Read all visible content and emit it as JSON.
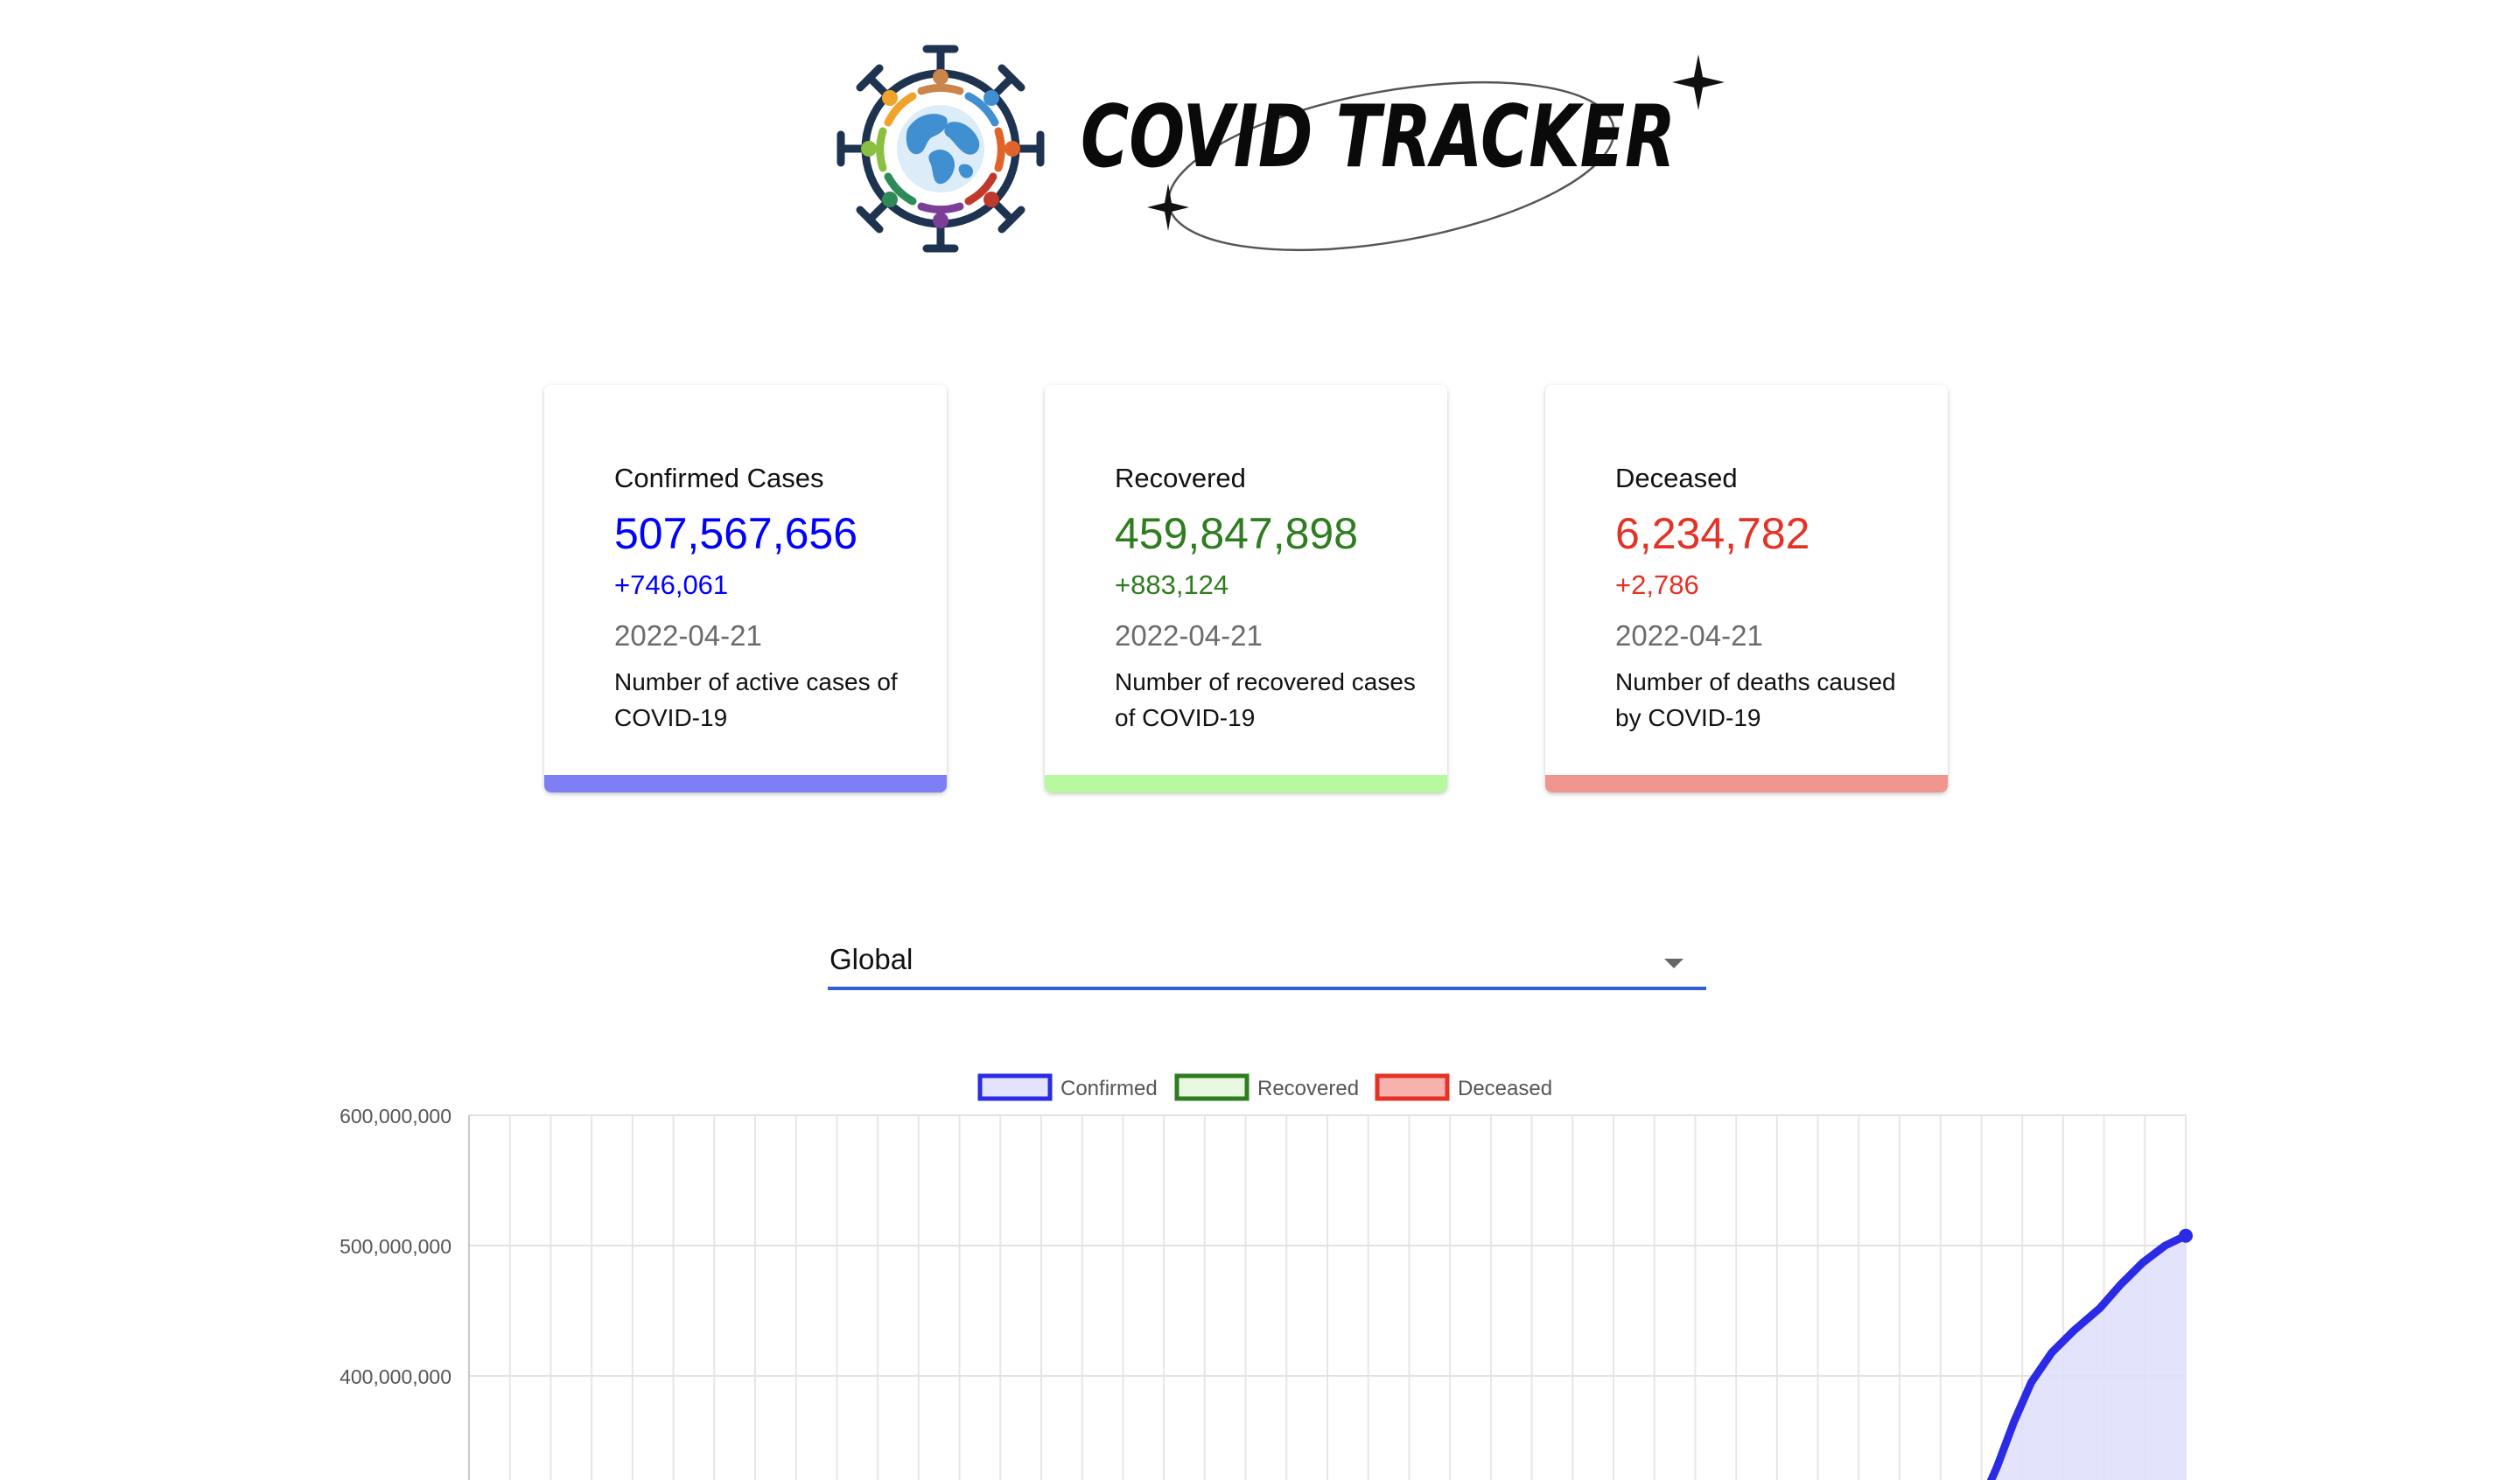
{
  "header": {
    "title": "COVID TRACKER"
  },
  "colors": {
    "confirmed": "#0000ff",
    "recovered": "#2e7d1e",
    "deceased": "#e53225",
    "confirmed_bar": "#7f7ff5",
    "recovered_bar": "#b6f9a0",
    "deceased_bar": "#f0958f",
    "select_underline": "#2f5fd6"
  },
  "cards": [
    {
      "title": "Confirmed Cases",
      "value": "507,567,656",
      "delta": "+746,061",
      "date": "2022-04-21",
      "description": "Number of active cases of COVID-19"
    },
    {
      "title": "Recovered",
      "value": "459,847,898",
      "delta": "+883,124",
      "date": "2022-04-21",
      "description": "Number of recovered cases of COVID-19"
    },
    {
      "title": "Deceased",
      "value": "6,234,782",
      "delta": "+2,786",
      "date": "2022-04-21",
      "description": "Number of deaths caused by COVID-19"
    }
  ],
  "country_select": {
    "selected": "Global"
  },
  "chart_data": {
    "type": "line",
    "legend": [
      "Confirmed",
      "Recovered",
      "Deceased"
    ],
    "legend_position": "top-center",
    "grid": true,
    "y_ticks": [
      "600,000,000",
      "500,000,000",
      "400,000,000"
    ],
    "ylim_visible": [
      300000000,
      600000000
    ],
    "series": [
      {
        "name": "Confirmed",
        "points": [
          [
            0.88,
            300000000
          ],
          [
            0.89,
            330000000
          ],
          [
            0.9,
            365000000
          ],
          [
            0.91,
            395000000
          ],
          [
            0.922,
            418000000
          ],
          [
            0.935,
            435000000
          ],
          [
            0.95,
            452000000
          ],
          [
            0.962,
            470000000
          ],
          [
            0.975,
            487000000
          ],
          [
            0.988,
            500000000
          ],
          [
            1.0,
            507567656
          ]
        ]
      }
    ]
  }
}
